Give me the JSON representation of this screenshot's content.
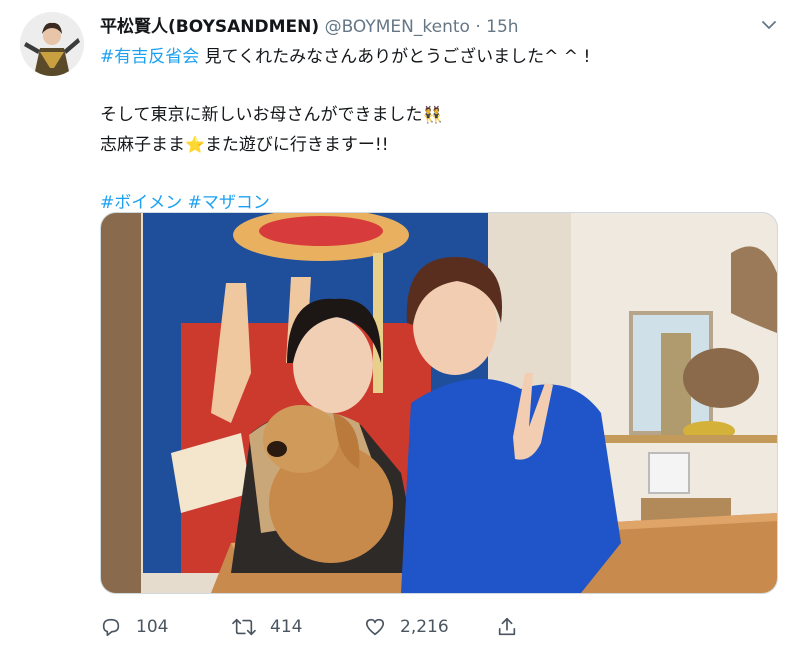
{
  "tweet": {
    "display_name": "平松賢人(BOYSANDMEN)",
    "handle": "@BOYMEN_kento",
    "separator": "·",
    "time": "15h",
    "line1_hashtag": "#有吉反省会",
    "line1_text": " 見てくれたみなさんありがとうございました^ ^ !",
    "line2_text": "そして東京に新しいお母さんができました",
    "line2_emoji": "👯",
    "line3_text_a": "志麻子まま",
    "line3_emoji": "⭐",
    "line3_text_b": "また遊びに行きますー!!",
    "hashtag_1": "#ボイメン",
    "hashtag_2": "#マザコン",
    "icons": [
      "chevron-down-icon",
      "reply-icon",
      "retweet-icon",
      "like-icon",
      "share-icon"
    ]
  },
  "actions": {
    "replies": "104",
    "retweets": "414",
    "likes": "2,216"
  },
  "colors": {
    "link": "#1da1f2",
    "text": "#14171a",
    "muted": "#657786",
    "border": "#cfd9de"
  }
}
